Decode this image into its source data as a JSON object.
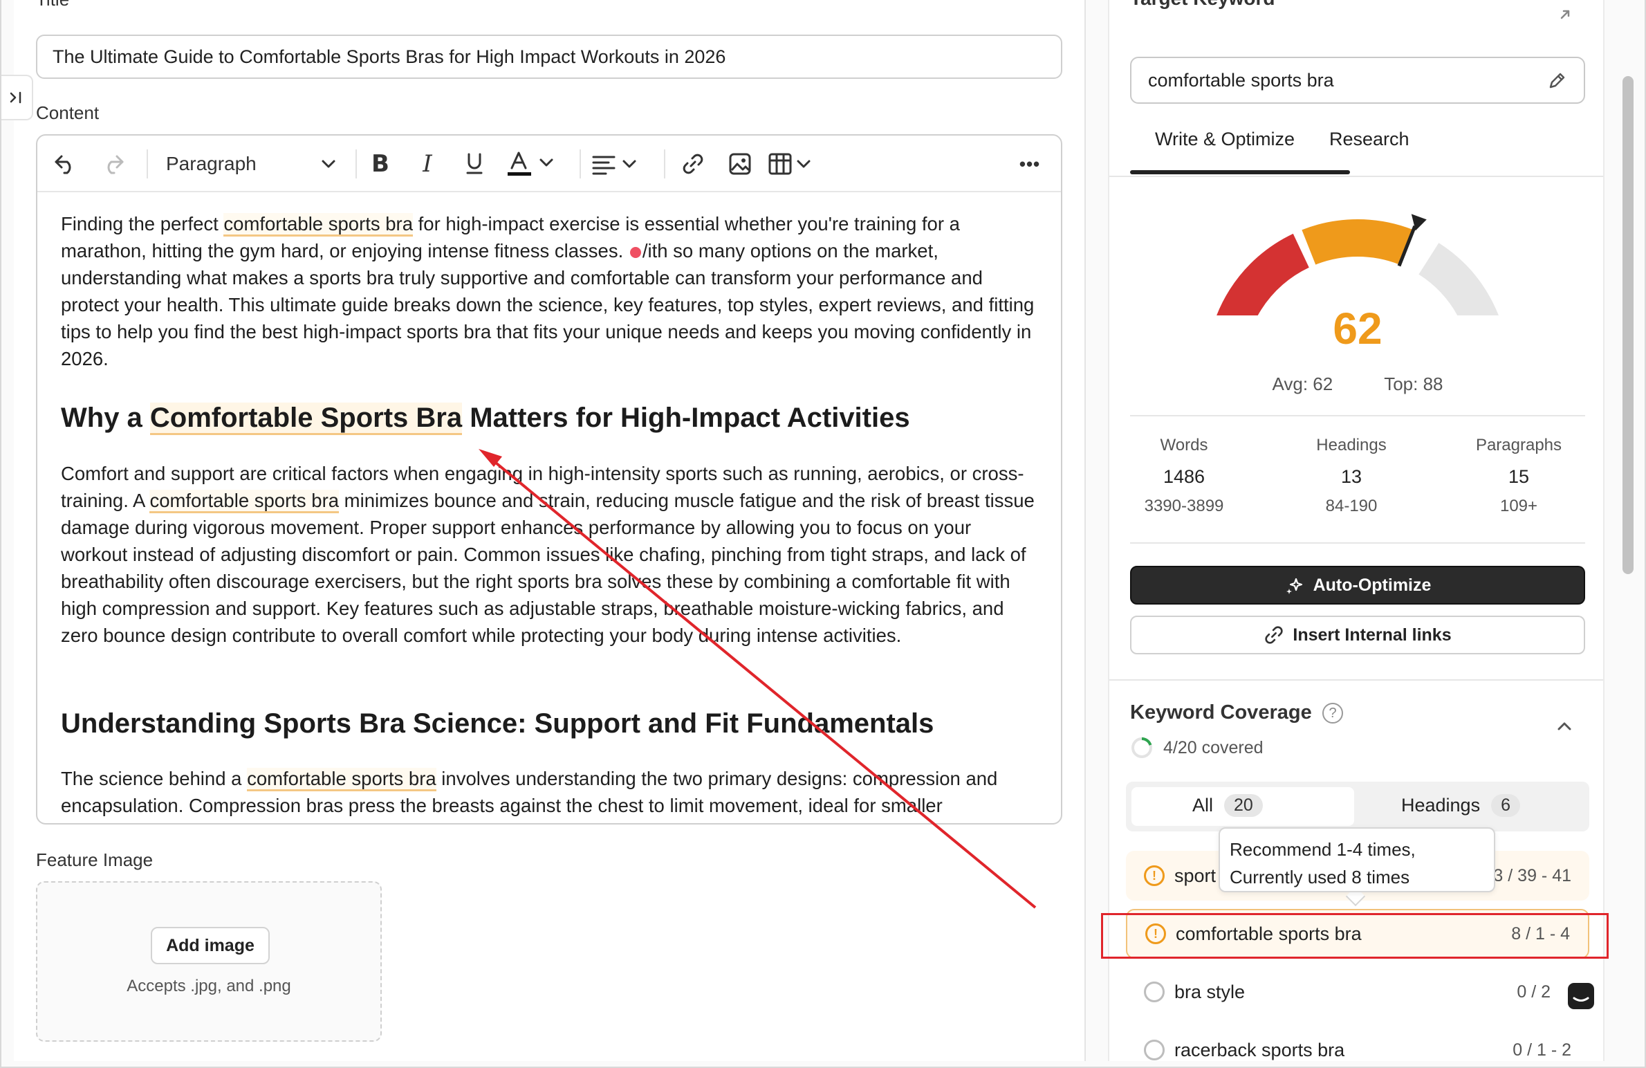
{
  "editor": {
    "title_label": "Title",
    "title_value": "The Ultimate Guide to Comfortable Sports Bras for High Impact Workouts in 2026",
    "content_label": "Content",
    "toolbar": {
      "paragraph_select": "Paragraph",
      "more_label": "•••"
    },
    "paragraph1": {
      "pre": "Finding the perfect ",
      "kw": "comfortable sports bra",
      "mid": " for high-impact exercise is essential whether you're training for a marathon, hitting the gym hard, or enjoying intense fitness classes. ",
      "post": "/ith so many options on the market, understanding what makes a sports bra truly supportive and comfortable can transform your performance and protect your health. This ultimate guide breaks down the science, key features, top styles, expert reviews, and fitting tips to help you find the best high-impact sports bra that fits your unique needs and keeps you moving confidently in 2026."
    },
    "heading1": {
      "pre": "Why a ",
      "kw": "Comfortable Sports Bra",
      "post": " Matters for High-Impact Activities"
    },
    "paragraph2": {
      "pre": "Comfort and support are critical factors when engaging in high-intensity sports such as running, aerobics, or cross-training. A ",
      "kw": "comfortable sports bra",
      "post": " minimizes bounce and strain, reducing muscle fatigue and the risk of breast tissue damage during vigorous movement. Proper support enhances performance by allowing you to focus on your workout instead of adjusting discomfort or pain. Common issues like chafing, pinching from tight straps, and lack of breathability often discourage exercisers, but the right sports bra solves these by combining a comfortable fit with high compression and support. Key features such as adjustable straps, breathable moisture-wicking fabrics, and zero bounce design contribute to overall comfort while protecting your body during intense activities."
    },
    "heading2": "Understanding Sports Bra Science: Support and Fit Fundamentals",
    "paragraph3": {
      "pre": "The science behind a ",
      "kw": "comfortable sports bra",
      "post": " involves understanding the two primary designs: compression and encapsulation. Compression bras press the breasts against the chest to limit movement, ideal for smaller"
    },
    "feature_image_label": "Feature Image",
    "add_image_label": "Add image",
    "accepts_text": "Accepts .jpg, and .png"
  },
  "sidebar": {
    "target_keyword_label": "Target Keyword",
    "target_keyword_value": "comfortable sports bra",
    "tabs": [
      "Write & Optimize",
      "Research"
    ],
    "active_tab": "Write & Optimize",
    "score": "62",
    "score_value": 62,
    "score_max": 100,
    "avg_label": "Avg: 62",
    "top_label": "Top: 88",
    "stats": [
      {
        "label": "Words",
        "value": "1486",
        "range": "3390-3899"
      },
      {
        "label": "Headings",
        "value": "13",
        "range": "84-190"
      },
      {
        "label": "Paragraphs",
        "value": "15",
        "range": "109+"
      }
    ],
    "auto_optimize_label": "Auto-Optimize",
    "internal_links_label": "Insert Internal links",
    "keyword_coverage": {
      "title": "Keyword Coverage",
      "covered_text": "4/20 covered",
      "covered_fraction": 0.2,
      "filters": [
        {
          "label": "All",
          "count": "20"
        },
        {
          "label": "Headings",
          "count": "6"
        }
      ],
      "rows": [
        {
          "name": "sport",
          "ratio": "3 / 39 - 41",
          "status": "warning"
        },
        {
          "name": "comfortable sports bra",
          "ratio": "8 / 1 - 4",
          "status": "warning"
        },
        {
          "name": "bra style",
          "ratio": "0 / 2",
          "status": "missing"
        },
        {
          "name": "racerback sports bra",
          "ratio": "0 / 1 - 2",
          "status": "missing"
        }
      ],
      "tooltip_line1": "Recommend 1-4 times,",
      "tooltip_line2": "Currently used 8 times"
    }
  },
  "colors": {
    "score_orange": "#ef9a1b",
    "gauge_red": "#d43232",
    "gauge_grey": "#e6e6e6",
    "annotation_red": "#e0252b",
    "keyword_underline": "#f4c784"
  }
}
